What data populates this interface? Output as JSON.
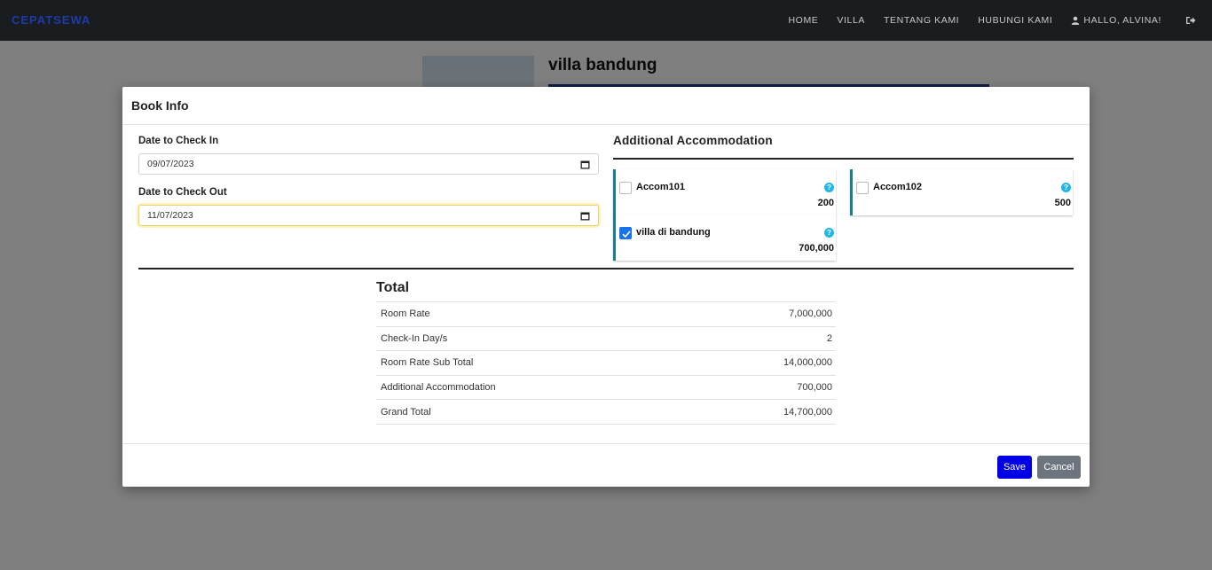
{
  "navbar": {
    "brand": "CEPATSEWA",
    "links": [
      "HOME",
      "VILLA",
      "TENTANG KAMI",
      "HUBUNGI KAMI"
    ],
    "user_greeting": "HALLO, ALVINA!"
  },
  "background_page": {
    "title": "villa bandung"
  },
  "modal": {
    "title": "Book Info",
    "check_in": {
      "label": "Date to Check In",
      "value": "09/07/2023"
    },
    "check_out": {
      "label": "Date to Check Out",
      "value": "11/07/2023"
    },
    "accommodation": {
      "title": "Additional Accommodation",
      "items": [
        {
          "name": "Accom101",
          "price": "200",
          "checked": false
        },
        {
          "name": "Accom102",
          "price": "500",
          "checked": false
        },
        {
          "name": "villa di bandung",
          "price": "700,000",
          "checked": true
        }
      ],
      "help_glyph": "?"
    },
    "total": {
      "title": "Total",
      "rows": [
        {
          "label": "Room Rate",
          "value": "7,000,000"
        },
        {
          "label": "Check-In Day/s",
          "value": "2"
        },
        {
          "label": "Room Rate Sub Total",
          "value": "14,000,000"
        },
        {
          "label": "Additional Accommodation",
          "value": "700,000"
        },
        {
          "label": "Grand Total",
          "value": "14,700,000"
        }
      ]
    },
    "buttons": {
      "save": "Save",
      "cancel": "Cancel"
    }
  },
  "colors": {
    "navbar_bg": "#1a1d20",
    "brand": "#1e3aa8",
    "card_accent": "#17808a",
    "save_button": "#0000e6",
    "cancel_button": "#6c757d",
    "checkbox_checked": "#1a73e8",
    "help_icon": "#1fb6ea"
  }
}
